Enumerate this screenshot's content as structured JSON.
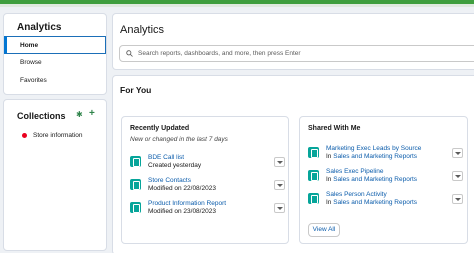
{
  "sidebar": {
    "title": "Analytics",
    "items": [
      {
        "label": "Home"
      },
      {
        "label": "Browse"
      },
      {
        "label": "Favorites"
      }
    ]
  },
  "collections": {
    "title": "Collections",
    "items": [
      {
        "label": "Store information",
        "color": "#ea001e"
      }
    ]
  },
  "header": {
    "title": "Analytics",
    "search_placeholder": "Search reports, dashboards, and more, then press Enter"
  },
  "for_you": {
    "title": "For You",
    "recently_updated": {
      "title": "Recently Updated",
      "subtitle": "New or changed in the last 7 days",
      "items": [
        {
          "name": "BDE Call list",
          "detail": "Created yesterday"
        },
        {
          "name": "Store Contacts",
          "detail": "Modified on 22/08/2023"
        },
        {
          "name": "Product Information Report",
          "detail": "Modified on 23/08/2023"
        }
      ]
    },
    "shared_with_me": {
      "title": "Shared With Me",
      "items": [
        {
          "name": "Marketing Exec Leads by Source",
          "prefix": "In",
          "folder": "Sales and Marketing Reports"
        },
        {
          "name": "Sales Exec Pipeline",
          "prefix": "In",
          "folder": "Sales and Marketing Reports"
        },
        {
          "name": "Sales Person Activity",
          "prefix": "In",
          "folder": "Sales and Marketing Reports"
        }
      ],
      "view_all": "View All"
    }
  },
  "colors": {
    "accent": "#0176d3",
    "icon_teal": "#06a59a",
    "link": "#0b5cab",
    "brand_green": "#3e9e3e"
  }
}
